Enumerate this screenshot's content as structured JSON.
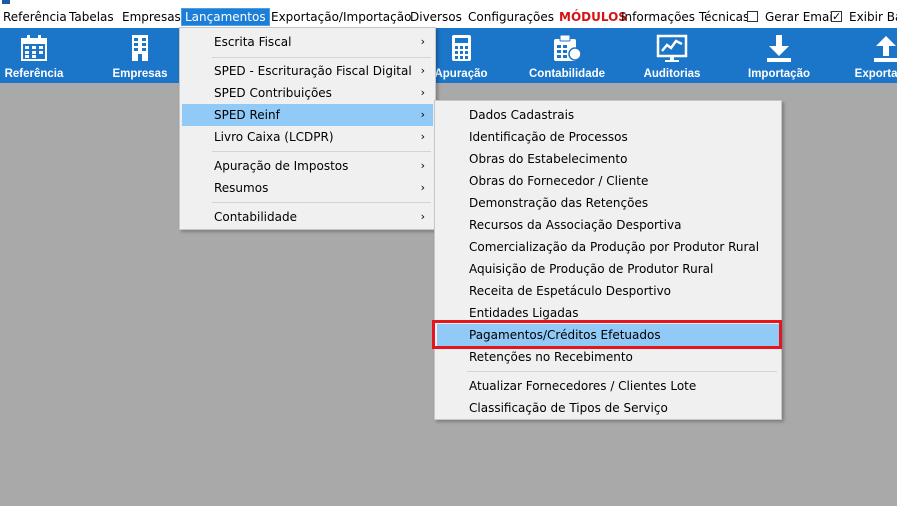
{
  "menubar": {
    "items": [
      "Referência",
      "Tabelas",
      "Empresas",
      "Lançamentos",
      "Exportação/Importação",
      "Diversos",
      "Configurações",
      "MÓDULOS",
      "Informações Técnicas"
    ],
    "gerar_email": "Gerar Email",
    "exibir_bar": "Exibir Bar"
  },
  "toolbar": {
    "items": [
      {
        "label": "Referência",
        "icon": "calendar-icon"
      },
      {
        "label": "Empresas",
        "icon": "building-icon"
      },
      {
        "label": "Apuração",
        "icon": "calculator-icon"
      },
      {
        "label": "Contabilidade",
        "icon": "accounting-icon"
      },
      {
        "label": "Auditorias",
        "icon": "chart-monitor-icon"
      },
      {
        "label": "Importação",
        "icon": "download-icon"
      },
      {
        "label": "Exportação",
        "icon": "upload-icon"
      }
    ]
  },
  "lancamentos_menu": {
    "items": [
      "Escrita Fiscal",
      "SPED - Escrituração Fiscal Digital",
      "SPED Contribuições",
      "SPED Reinf",
      "Livro Caixa (LCDPR)",
      "Apuração de Impostos",
      "Resumos",
      "Contabilidade"
    ]
  },
  "reinf_menu": {
    "items": [
      "Dados Cadastrais",
      "Identificação de Processos",
      "Obras do Estabelecimento",
      "Obras do Fornecedor / Cliente",
      "Demonstração das Retenções",
      "Recursos da Associação Desportiva",
      "Comercialização da Produção por Produtor Rural",
      "Aquisição de Produção de Produtor Rural",
      "Receita de Espetáculo Desportivo",
      "Entidades Ligadas",
      "Pagamentos/Créditos Efetuados",
      "Retenções no Recebimento",
      "Atualizar Fornecedores / Clientes Lote",
      "Classificação de Tipos de Serviço"
    ]
  },
  "colors": {
    "toolbar_bg": "#1b75c9",
    "workspace_bg": "#a9a9a9",
    "highlight": "#91c9f7",
    "annotation_red": "#e3151f",
    "modulos_red": "#d41414"
  }
}
